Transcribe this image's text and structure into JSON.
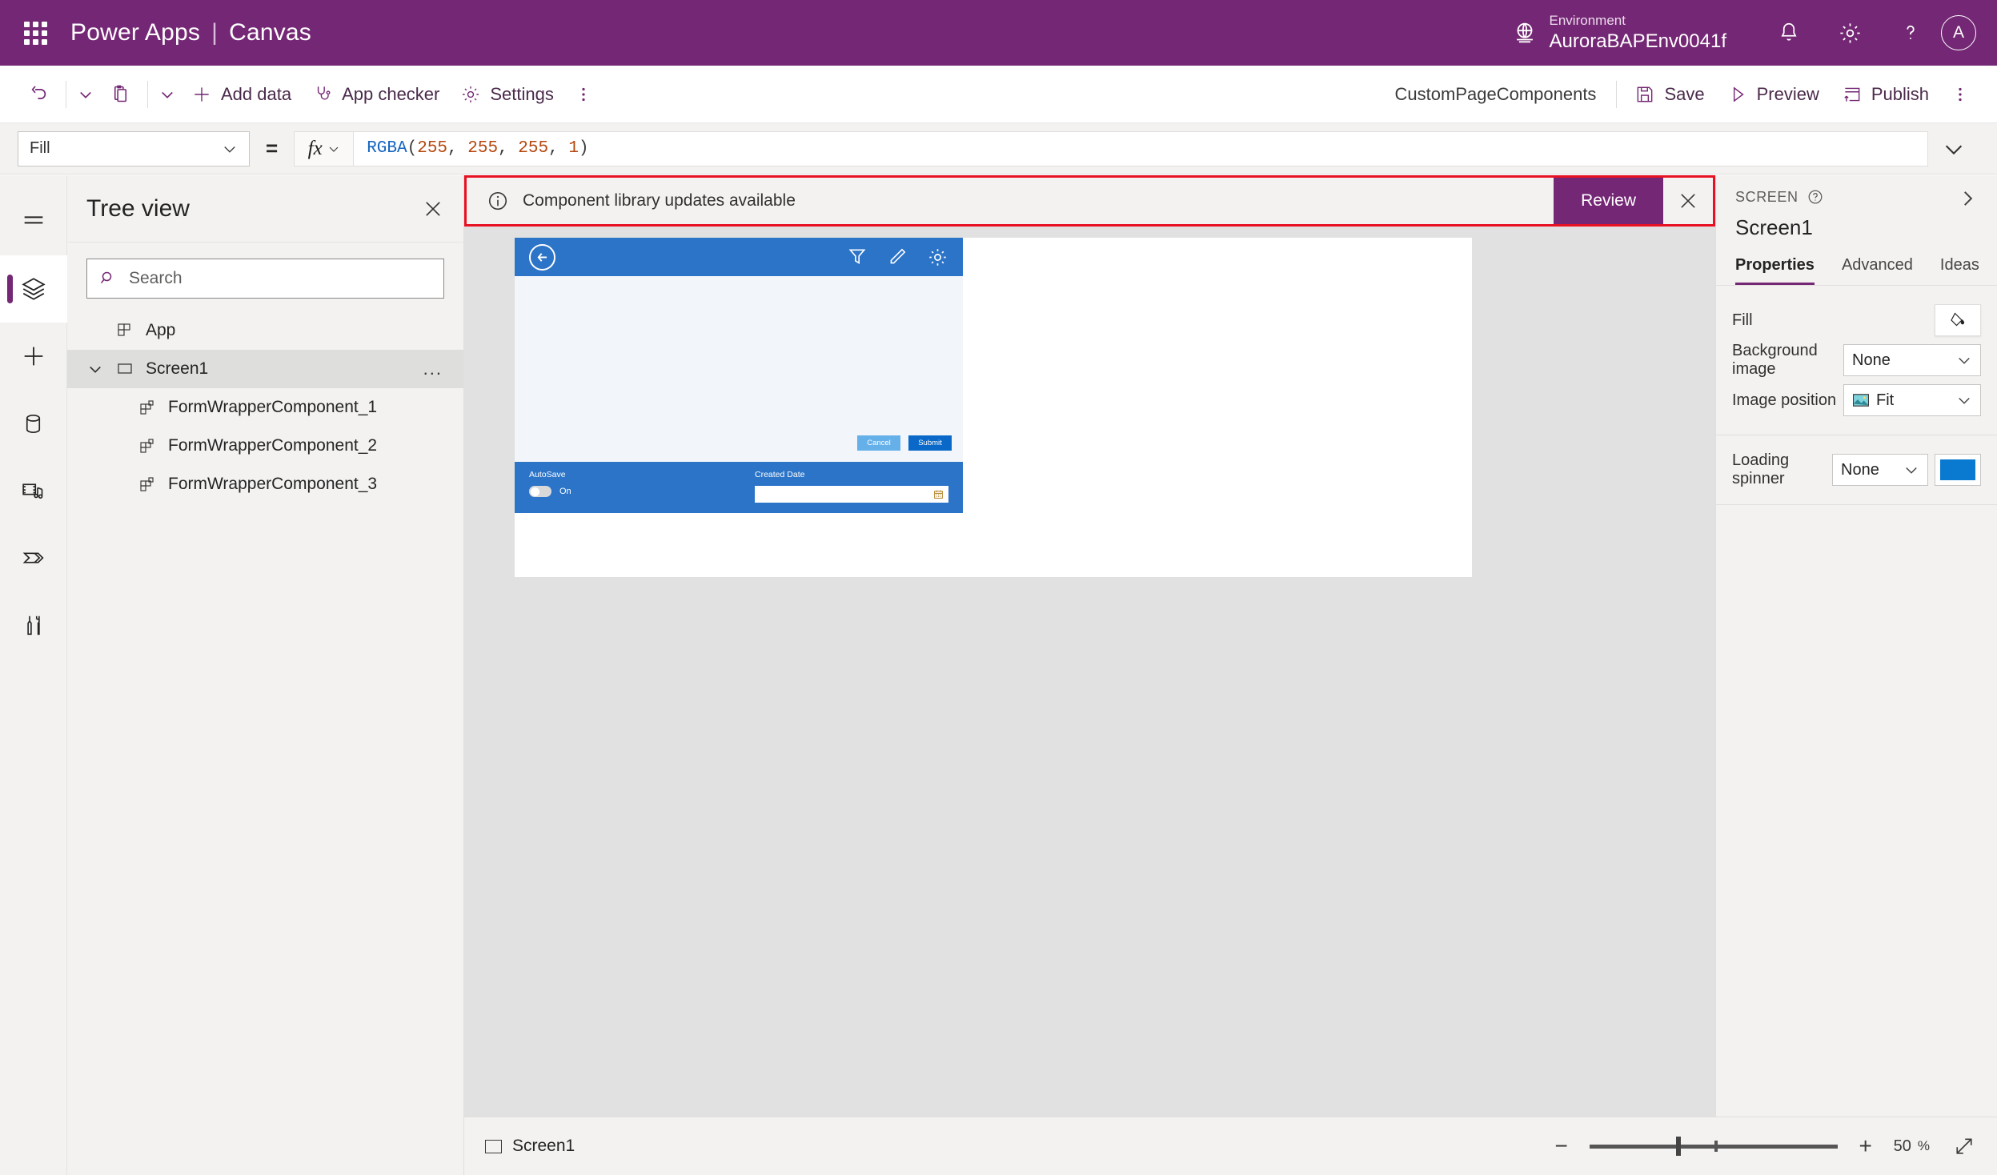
{
  "header": {
    "waffle_icon": "app-launcher-icon",
    "brand": "Power Apps",
    "brand_separator": "|",
    "product": "Canvas",
    "environment_label": "Environment",
    "environment_value": "AuroraBAPEnv0041f",
    "globe_icon": "environment-globe-icon",
    "notification_icon": "bell-icon",
    "settings_icon": "gear-icon",
    "help_icon": "question-mark-icon",
    "avatar_initial": "A",
    "brand_color": "#742774"
  },
  "commandbar": {
    "undo_icon": "undo-icon",
    "paste_icon": "paste-icon",
    "chevron_icon": "chevron-down-icon",
    "add_data": "Add data",
    "app_checker": "App checker",
    "settings": "Settings",
    "overflow_icon": "more-vertical-icon",
    "app_name": "CustomPageComponents",
    "save": "Save",
    "preview": "Preview",
    "publish": "Publish"
  },
  "formulabar": {
    "property": "Fill",
    "equals": "=",
    "fx_label": "fx",
    "formula_fn": "RGBA",
    "formula_open": "(",
    "formula_args": [
      "255",
      "255",
      "255",
      "1"
    ],
    "formula_close": ")",
    "formula_full": "RGBA(255, 255, 255, 1)",
    "expand_icon": "chevron-down-icon"
  },
  "rail": {
    "items": [
      {
        "name": "hamburger-menu-icon",
        "active": false
      },
      {
        "name": "tree-view-layers-icon",
        "active": true
      },
      {
        "name": "insert-plus-icon",
        "active": false
      },
      {
        "name": "data-cylinder-icon",
        "active": false
      },
      {
        "name": "media-icon",
        "active": false
      },
      {
        "name": "power-automate-icon",
        "active": false
      },
      {
        "name": "variables-tools-icon",
        "active": false
      }
    ]
  },
  "treeview": {
    "title": "Tree view",
    "close_icon": "close-icon",
    "search_placeholder": "Search",
    "search_value": "",
    "search_icon": "search-icon",
    "items": [
      {
        "label": "App",
        "level": 1,
        "icon": "app-component-icon",
        "selected": false,
        "expandable": false
      },
      {
        "label": "Screen1",
        "level": 1,
        "icon": "screen-icon",
        "selected": true,
        "expandable": true,
        "overflow": "..."
      },
      {
        "label": "FormWrapperComponent_1",
        "level": 2,
        "icon": "component-icon",
        "selected": false,
        "expandable": false
      },
      {
        "label": "FormWrapperComponent_2",
        "level": 2,
        "icon": "component-icon",
        "selected": false,
        "expandable": false
      },
      {
        "label": "FormWrapperComponent_3",
        "level": 2,
        "icon": "component-icon",
        "selected": false,
        "expandable": false
      }
    ]
  },
  "banner": {
    "info_icon": "info-circle-icon",
    "message": "Component library updates available",
    "action_label": "Review",
    "close_icon": "close-icon",
    "border_color": "#e81123",
    "action_color": "#742774"
  },
  "canvas": {
    "app_bar_color": "#2b74c8",
    "back_icon": "back-arrow-circle-icon",
    "filter_icon": "filter-icon",
    "edit_icon": "pencil-edit-icon",
    "gear_icon": "gear-icon",
    "cancel_label": "Cancel",
    "submit_label": "Submit",
    "cancel_color": "#66b0ea",
    "submit_color": "#0a69c8",
    "autosave_label": "AutoSave",
    "autosave_state": "On",
    "created_date_label": "Created Date",
    "created_date_value": "",
    "calendar_icon": "calendar-icon",
    "toggle_icon": "toggle-switch-icon"
  },
  "properties": {
    "kicker": "SCREEN",
    "help_icon": "question-circle-icon",
    "collapse_icon": "chevron-right-icon",
    "selected_name": "Screen1",
    "tabs": [
      {
        "label": "Properties",
        "active": true
      },
      {
        "label": "Advanced",
        "active": false
      },
      {
        "label": "Ideas",
        "active": false
      }
    ],
    "rows": [
      {
        "label": "Fill",
        "control": "fill-swatch",
        "value": "",
        "icon": "paint-bucket-icon"
      },
      {
        "label": "Background image",
        "control": "dropdown",
        "value": "None"
      },
      {
        "label": "Image position",
        "control": "dropdown-with-icon",
        "value": "Fit",
        "icon": "image-icon"
      }
    ],
    "spinner_row": {
      "label": "Loading spinner",
      "value": "None",
      "color": "#0a7ad1"
    }
  },
  "statusbar": {
    "screen_label": "Screen1",
    "screen_icon": "screen-icon",
    "zoom_out_icon": "minus-icon",
    "zoom_in_icon": "plus-icon",
    "zoom_value": "50",
    "zoom_unit": "%",
    "fit_icon": "fit-screen-diagonal-icon"
  }
}
